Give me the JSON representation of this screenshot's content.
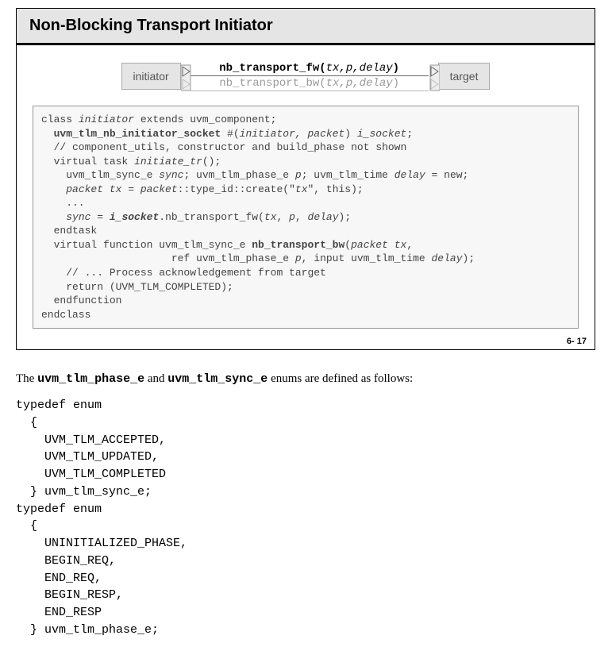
{
  "slide": {
    "title": "Non-Blocking Transport Initiator",
    "diagram": {
      "left_node": "initiator",
      "right_node": "target",
      "call_fw_prefix": "nb_transport_fw(",
      "call_fw_args": "tx,p,delay",
      "call_fw_suffix": ")",
      "call_bw_prefix": "nb_transport_bw(",
      "call_bw_args": "tx,p,delay",
      "call_bw_suffix": ")"
    },
    "code": {
      "l1a": "class ",
      "l1b": "initiator",
      "l1c": " extends uvm_component;",
      "l2a": "  ",
      "l2b": "uvm_tlm_nb_initiator_socket",
      "l2c": " #(",
      "l2d": "initiator, packet",
      "l2e": ") ",
      "l2f": "i_socket",
      "l2g": ";",
      "l3": "  // component_utils, constructor and build_phase not shown",
      "l4a": "  virtual task ",
      "l4b": "initiate_tr",
      "l4c": "();",
      "l5a": "    uvm_tlm_sync_e ",
      "l5b": "sync",
      "l5c": "; uvm_tlm_phase_e ",
      "l5d": "p",
      "l5e": "; uvm_tlm_time ",
      "l5f": "delay",
      "l5g": " = new;",
      "l6a": "    ",
      "l6b": "packet tx",
      "l6c": " = ",
      "l6d": "packet",
      "l6e": "::type_id::create(\"",
      "l6f": "tx",
      "l6g": "\", this);",
      "l7": "    ...",
      "l8a": "    ",
      "l8b": "sync",
      "l8c": " = ",
      "l8d": "i_socket",
      "l8e": ".nb_transport_fw(",
      "l8f": "tx",
      "l8g": ", ",
      "l8h": "p",
      "l8i": ", ",
      "l8j": "delay",
      "l8k": ");",
      "l9": "  endtask",
      "l10a": "  virtual function uvm_tlm_sync_e ",
      "l10b": "nb_transport_bw",
      "l10c": "(",
      "l10d": "packet tx",
      "l10e": ",",
      "l11a": "                     ref uvm_tlm_phase_e ",
      "l11b": "p",
      "l11c": ", input uvm_tlm_time ",
      "l11d": "delay",
      "l11e": ");",
      "l12": "    // ... Process acknowledgement from target",
      "l13": "    return (UVM_TLM_COMPLETED);",
      "l14": "  endfunction",
      "l15": "endclass"
    },
    "page_num": "6- 17"
  },
  "body_text": {
    "t1": "The ",
    "t2": "uvm_tlm_phase_e",
    "t3": " and ",
    "t4": "uvm_tlm_sync_e",
    "t5": " enums are defined as follows:"
  },
  "enum_code": {
    "e1": "typedef enum",
    "e2": "  {",
    "e3": "    UVM_TLM_ACCEPTED,",
    "e4": "    UVM_TLM_UPDATED,",
    "e5": "    UVM_TLM_COMPLETED",
    "e6": "  } uvm_tlm_sync_e;",
    "e7": "typedef enum",
    "e8": "  {",
    "e9": "    UNINITIALIZED_PHASE,",
    "e10": "    BEGIN_REQ,",
    "e11": "    END_REQ,",
    "e12": "    BEGIN_RESP,",
    "e13": "    END_RESP",
    "e14": "  } uvm_tlm_phase_e;"
  }
}
